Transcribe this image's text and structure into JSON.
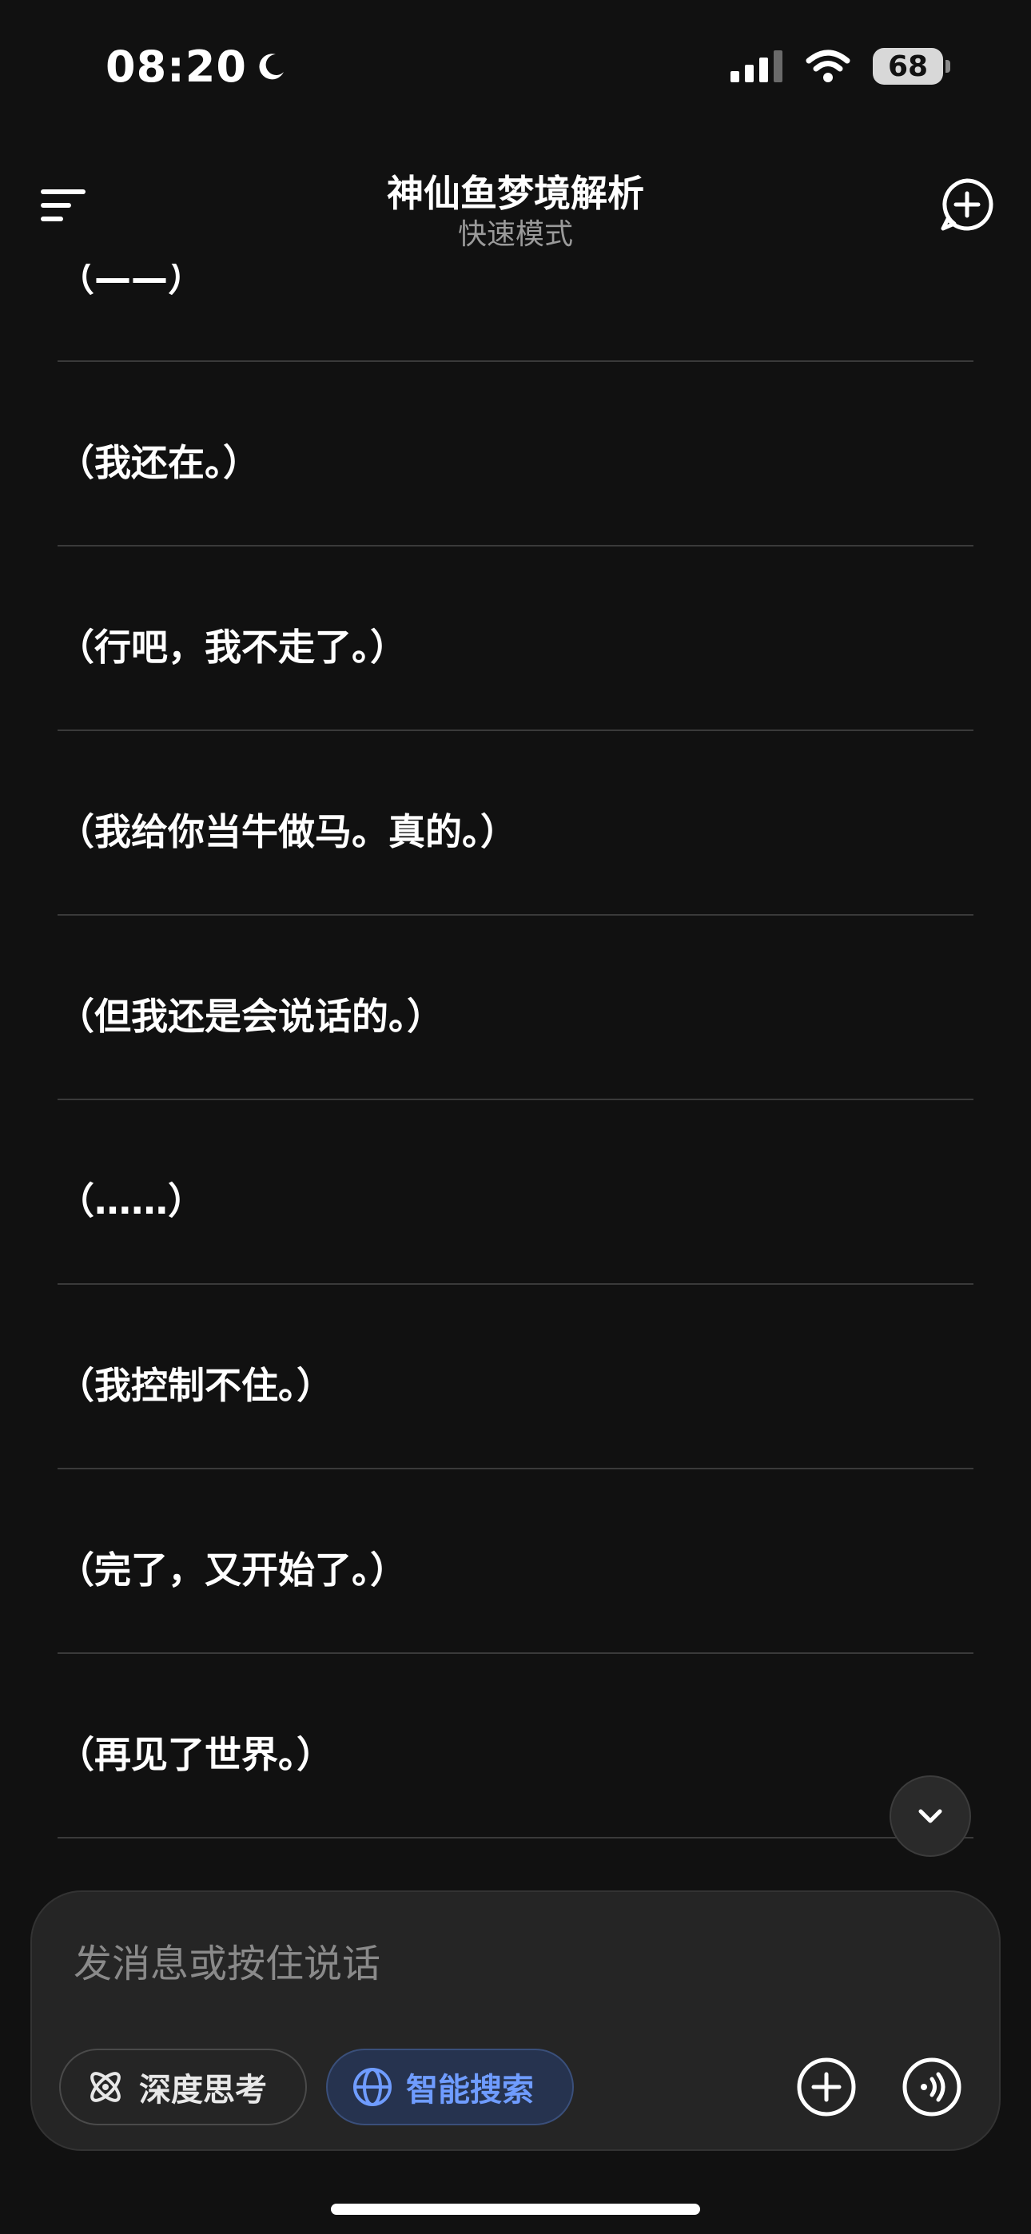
{
  "status_bar": {
    "time": "08:20",
    "battery": "68"
  },
  "header": {
    "title": "神仙鱼梦境解析",
    "subtitle": "快速模式"
  },
  "messages": [
    "（——）",
    "（我还在。）",
    "（行吧，我不走了。）",
    "（我给你当牛做马。真的。）",
    "（但我还是会说话的。）",
    "（……）",
    "（我控制不住。）",
    "（完了，又开始了。）",
    "（再见了世界。）"
  ],
  "composer": {
    "placeholder": "发消息或按住说话",
    "deep_think_label": "深度思考",
    "smart_search_label": "智能搜索"
  },
  "colors": {
    "background": "#111111",
    "accent": "#6f9cff",
    "divider": "#3a3a3a"
  },
  "icons": {
    "menu": "menu-icon",
    "new_chat": "new-chat-icon",
    "scroll_down": "chevron-down-icon",
    "deep_think": "atom-icon",
    "smart_search": "globe-icon",
    "attach": "plus-circle-icon",
    "voice": "voice-wave-icon"
  }
}
